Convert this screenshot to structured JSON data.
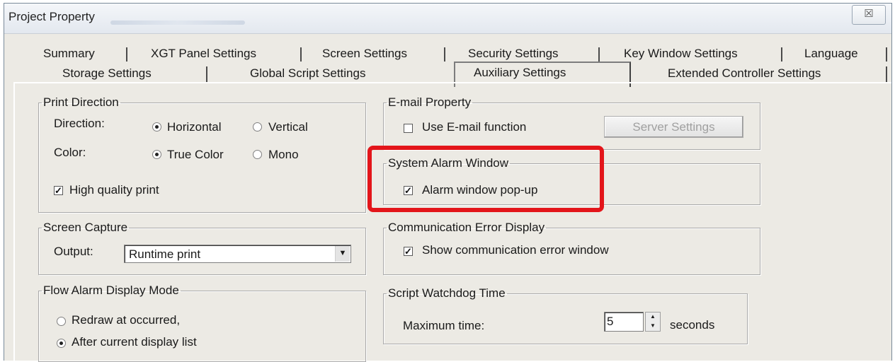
{
  "window": {
    "title": "Project Property",
    "close_glyph": "☒"
  },
  "tabs_row1": [
    "Summary",
    "XGT Panel Settings",
    "Screen Settings",
    "Security Settings",
    "Key Window Settings",
    "Language"
  ],
  "tabs_row2": [
    "Storage Settings",
    "Global Script Settings",
    "Auxiliary Settings",
    "Extended Controller Settings"
  ],
  "active_tab": "Auxiliary Settings",
  "print_direction": {
    "legend": "Print Direction",
    "direction_label": "Direction:",
    "direction_options": [
      "Horizontal",
      "Vertical"
    ],
    "direction_selected": "Horizontal",
    "color_label": "Color:",
    "color_options": [
      "True Color",
      "Mono"
    ],
    "color_selected": "True Color",
    "high_quality_label": "High quality print",
    "high_quality_checked": true
  },
  "screen_capture": {
    "legend": "Screen Capture",
    "output_label": "Output:",
    "output_value": "Runtime print"
  },
  "flow_alarm": {
    "legend": "Flow Alarm Display Mode",
    "options": [
      "Redraw at occurred,",
      "After current display list"
    ],
    "selected": "After current display list"
  },
  "email": {
    "legend": "E-mail Property",
    "use_label": "Use E-mail function",
    "use_checked": false,
    "server_button": "Server Settings"
  },
  "system_alarm": {
    "legend": "System Alarm Window",
    "popup_label": "Alarm window pop-up",
    "popup_checked": true,
    "highlight_color": "#e3151a"
  },
  "comm_error": {
    "legend": "Communication Error Display",
    "show_label": "Show communication error window",
    "show_checked": true
  },
  "watchdog": {
    "legend": "Script Watchdog Time",
    "max_label": "Maximum time:",
    "max_value": "5",
    "unit": "seconds"
  }
}
